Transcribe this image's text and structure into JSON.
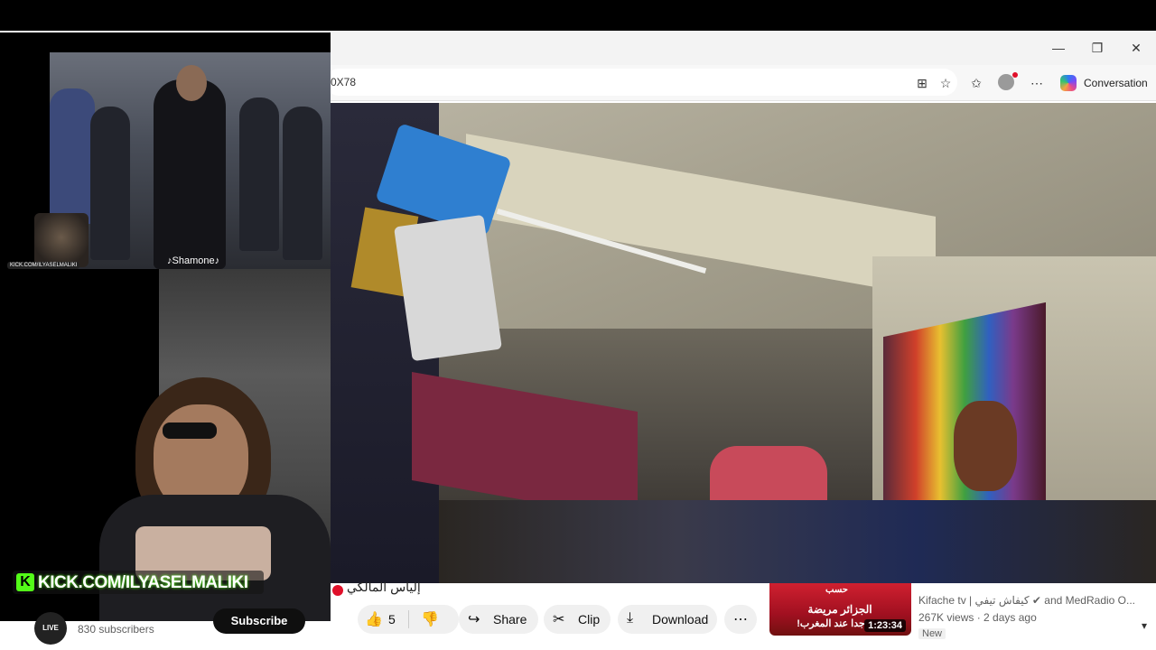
{
  "browser": {
    "address_text": "0X78",
    "conversation_label": "Conversation",
    "minimize_glyph": "—",
    "maximize_glyph": "❐",
    "close_glyph": "✕",
    "icons": [
      "split-screen-icon",
      "favorite-star-icon",
      "favorites-list-icon",
      "profile-icon",
      "more-icon",
      "copilot-icon"
    ]
  },
  "overlay": {
    "clip_caption": "♪Shamone♪",
    "small_watermark": "KICK.COM/ILYASELMALIKI",
    "kick_banner": "KICK.COM/ILYASELMALIKI",
    "kick_logo": "K"
  },
  "video_page": {
    "title": "إلياس المالكي",
    "subscribers": "830 subscribers",
    "subscribe_label": "Subscribe",
    "avatar_label": "LIVE",
    "like_count": "5",
    "share_label": "Share",
    "clip_label": "Clip",
    "download_label": "Download"
  },
  "recommendation": {
    "thumb_top": "حسب",
    "thumb_line1": "الجزائر مريضة",
    "thumb_line2": "جدا عند المغرب!",
    "duration": "1:23:34",
    "channel": "Kifache tv | كيفاش تيفي ✔ and MedRadio O...",
    "meta": "267K views · 2 days ago",
    "badge": "New"
  },
  "colors": {
    "kick_green": "#53fc18",
    "live_red": "#e0102a",
    "youtube_dark": "#0f0f0f"
  }
}
